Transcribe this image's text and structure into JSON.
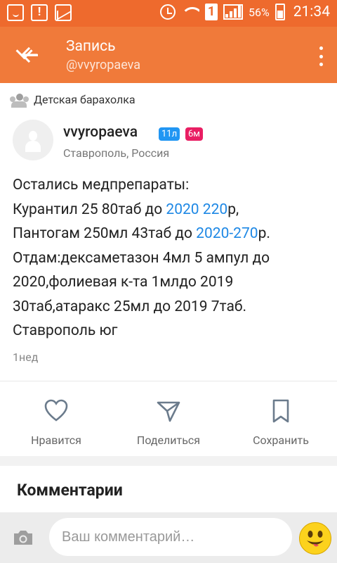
{
  "status_bar": {
    "battery_percent": "56%",
    "time": "21:34",
    "sim_label": "1"
  },
  "app_bar": {
    "title": "Запись",
    "subtitle": "@vvyropaeva"
  },
  "group": {
    "name": "Детская барахолка"
  },
  "author": {
    "name": "vvyropaeva",
    "badge_age": "11л",
    "badge_time": "6м",
    "location": "Ставрополь, Россия"
  },
  "post": {
    "line1": "Остались медпрепараты:",
    "line2_prefix": "Курантил 25 80таб до ",
    "line2_link": "2020 220",
    "line2_suffix": "р,",
    "line3_prefix": "Пантогам 250мл 43таб до ",
    "line3_link": "2020-270",
    "line3_suffix": "р.",
    "line4": "Отдам:дексаметазон 4мл 5 ампул до",
    "line5": "2020,фолиевая к-та 1млдо 2019",
    "line6": "30таб,атаракс 25мл до 2019 7таб.",
    "line7": "Ставрополь юг",
    "time": "1нед"
  },
  "actions": {
    "like": "Нравится",
    "share": "Поделиться",
    "save": "Сохранить"
  },
  "comments": {
    "heading": "Комментарии",
    "input_placeholder": "Ваш комментарий…"
  },
  "colors": {
    "status_bar": "#ee6a2d",
    "app_bar": "#f07a3a",
    "link": "#1e88e5",
    "badge_blue": "#2196f3",
    "badge_red": "#e91e63"
  }
}
